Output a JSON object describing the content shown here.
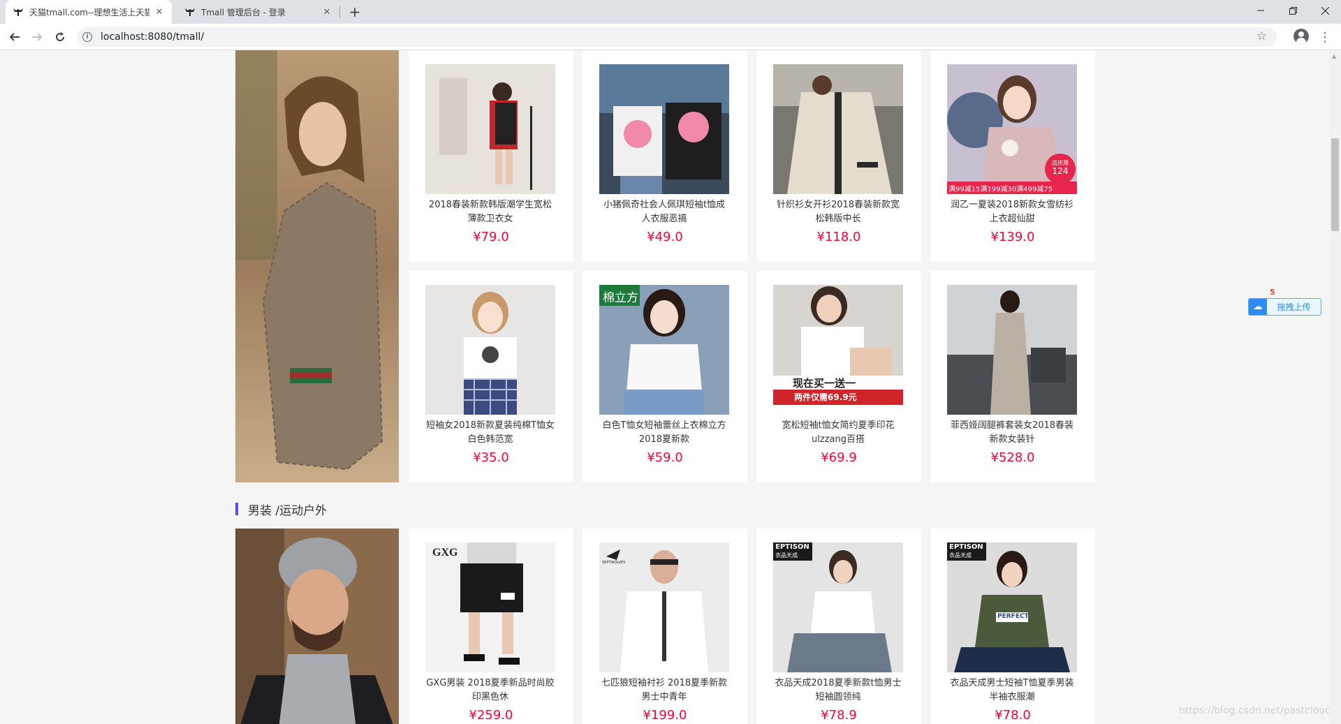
{
  "browser": {
    "tabs": [
      {
        "title": "天猫tmall.com--理想生活上天猫",
        "active": true
      },
      {
        "title": "Tmall 管理后台 - 登录",
        "active": false
      }
    ],
    "url": "localhost:8080/tmall/"
  },
  "category": {
    "title": "男装 /运动户外"
  },
  "womens_products": [
    {
      "name": "2018春装新款韩版潮学生宽松薄款卫衣女",
      "price": "¥79.0"
    },
    {
      "name": "小猪佩奇社会人佩琪短袖t恤成人衣服恶搞",
      "price": "¥49.0"
    },
    {
      "name": "针织衫女开衫2018春装新款宽松韩版中长",
      "price": "¥118.0"
    },
    {
      "name": "润乙一夏装2018新款女雪纺衫上衣超仙甜",
      "price": "¥139.0"
    },
    {
      "name": "短袖女2018新款夏装纯棉T恤女白色韩范宽",
      "price": "¥35.0"
    },
    {
      "name": "白色T恤女短袖蕾丝上衣棉立方2018夏新款",
      "price": "¥59.0"
    },
    {
      "name": "宽松短袖t恤女简约夏季印花ulzzang百搭",
      "price": "¥69.9"
    },
    {
      "name": "菲西娅阔腿裤套装女2018春装新款女装针",
      "price": "¥528.0"
    }
  ],
  "mens_products": [
    {
      "name": "GXG男装 2018夏季新品时尚胶印黑色休",
      "price": "¥259.0"
    },
    {
      "name": "七匹狼短袖衬衫 2018夏季新款男士中青年",
      "price": "¥199.0"
    },
    {
      "name": "衣品天成2018夏季新款t恤男士短袖圆领纯",
      "price": "¥78.9"
    },
    {
      "name": "衣品天成男士短袖T恤夏季男装半袖衣服潮",
      "price": "¥78.0"
    }
  ],
  "image_text": {
    "promo_strip": "满99减15满199减30满499减75",
    "promo_badge_top": "店庆用",
    "promo_badge_price": "124",
    "cotton_tag": "棉立方",
    "buy_banner": "现在买一送一",
    "buy_banner_sub": "两件仅需69.9元",
    "gxg_logo": "GXG",
    "septwolves_logo": "SEPTWOLVES",
    "eptison_logo": "EPTISON",
    "eptison_sub": "衣品天成",
    "perfect_print": "PERFECT"
  },
  "overlay": {
    "h5_label": "5",
    "upload_label": "拖拽上传",
    "watermark": "https://blog.csdn.net/pastclouds"
  },
  "colors": {
    "price": "#ff0036",
    "accent_bar": "#6347ed",
    "page_bg": "#f5f5f5"
  }
}
